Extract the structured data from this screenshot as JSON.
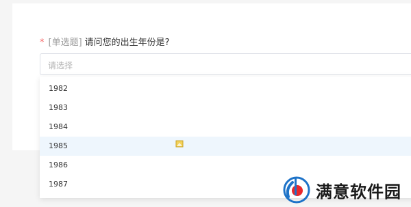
{
  "question": {
    "required_mark": "*",
    "type_label": "[单选题]",
    "text": "请问您的出生年份是?"
  },
  "select": {
    "placeholder": "请选择",
    "options": [
      "1982",
      "1983",
      "1984",
      "1985",
      "1986",
      "1987"
    ],
    "hovered_option": "1985"
  },
  "watermark": {
    "text": "满意软件园",
    "icon": "brand-logo-icon"
  },
  "colors": {
    "required": "#f56c6c",
    "hover_bg": "#eef6fd",
    "logo_blue": "#1e73c8",
    "logo_red": "#e8282b"
  }
}
